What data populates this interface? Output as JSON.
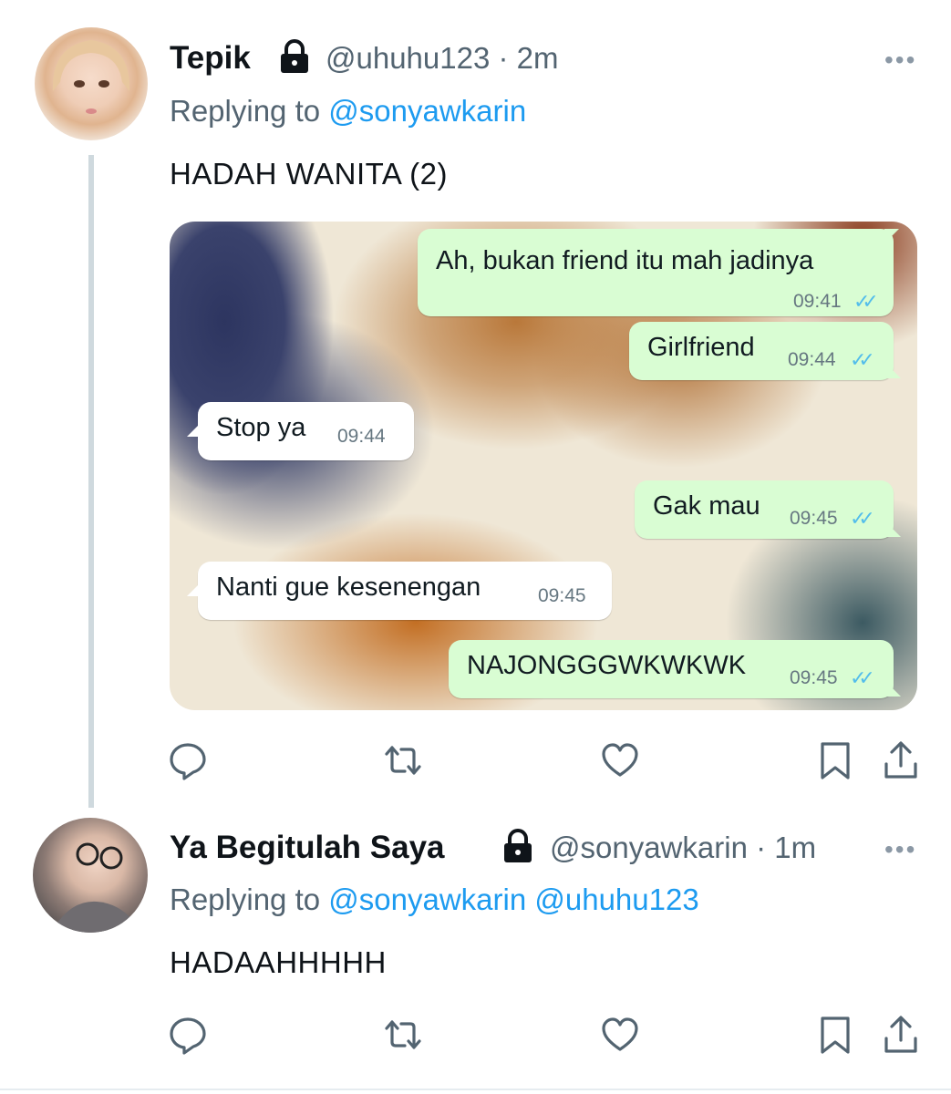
{
  "colors": {
    "accent": "#1d9bf0",
    "secondary_text": "#536471",
    "wa_out": "#d9fdd3",
    "wa_check": "#53bdeb"
  },
  "tweets": [
    {
      "name": "Tepik",
      "lock_icon": "lock-icon",
      "handle": "@uhuhu123",
      "separator": "·",
      "time": "2m",
      "more": "•••",
      "replying_prefix": "Replying to",
      "replying_to": [
        "@sonyawkarin"
      ],
      "text": "HADAH WANITA (2)"
    },
    {
      "name": "Ya Begitulah Saya",
      "lock_icon": "lock-icon",
      "handle": "@sonyawkarin",
      "separator": "·",
      "time": "1m",
      "more": "•••",
      "replying_prefix": "Replying to",
      "replying_to": [
        "@sonyawkarin",
        "@uhuhu123"
      ],
      "text": "HADAAHHHHH"
    }
  ],
  "chat": {
    "messages": [
      {
        "direction": "out",
        "text": "Ah, bukan friend itu mah jadinya",
        "time": "09:41",
        "check": "✓✓"
      },
      {
        "direction": "out",
        "text": "Girlfriend",
        "time": "09:44",
        "check": "✓✓"
      },
      {
        "direction": "in",
        "text": "Stop ya",
        "time": "09:44"
      },
      {
        "direction": "out",
        "text": "Gak mau",
        "time": "09:45",
        "check": "✓✓"
      },
      {
        "direction": "in",
        "text": "Nanti gue kesenengan",
        "time": "09:45"
      },
      {
        "direction": "out",
        "text": "NAJONGGGWKWKWK",
        "time": "09:45",
        "check": "✓✓"
      }
    ]
  },
  "actions": [
    "reply-icon",
    "retweet-icon",
    "like-icon",
    "bookmark-icon",
    "share-icon"
  ]
}
